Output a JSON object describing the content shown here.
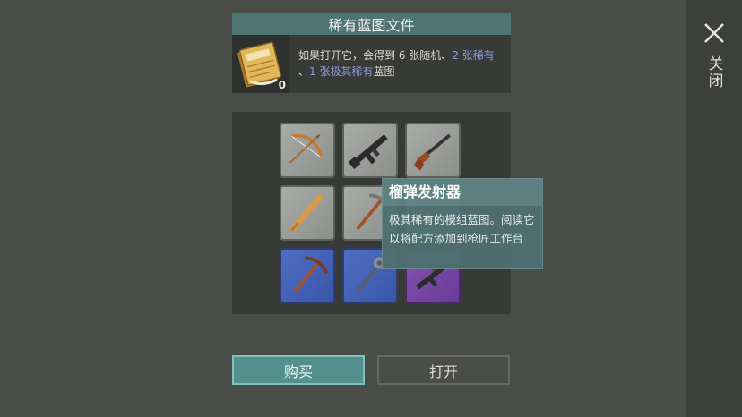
{
  "dialog": {
    "title": "稀有蓝图文件",
    "book_count": "0",
    "info": {
      "part1": "如果打开它，会得到 6 张随机、",
      "highlight1": "2 张稀有",
      "part2": "、",
      "highlight2": "1 张极其稀有",
      "part3": "蓝图"
    }
  },
  "slots": [
    {
      "rarity": "grey",
      "icon": "bow-icon"
    },
    {
      "rarity": "grey",
      "icon": "rifle-icon"
    },
    {
      "rarity": "grey",
      "icon": "shotgun-icon"
    },
    {
      "rarity": "grey",
      "icon": "baseball-bat-icon"
    },
    {
      "rarity": "grey",
      "icon": "pickaxe-icon"
    },
    {
      "rarity": "grey",
      "icon": "hidden-icon"
    },
    {
      "rarity": "blue",
      "icon": "pickaxe-icon"
    },
    {
      "rarity": "blue",
      "icon": "mace-icon"
    },
    {
      "rarity": "purple",
      "icon": "grenade-launcher-icon"
    }
  ],
  "tooltip": {
    "title": "榴弹发射器",
    "body": "极其稀有的模组蓝图。阅读它以将配方添加到枪匠工作台"
  },
  "buttons": {
    "buy": "购买",
    "open": "打开"
  },
  "sidebar": {
    "close_label": "关闭"
  },
  "colors": {
    "accent": "#53908d",
    "highlight_text": "#8d9bd6",
    "rare_blue": "#4f6fc4",
    "epic_purple": "#8452b0"
  }
}
